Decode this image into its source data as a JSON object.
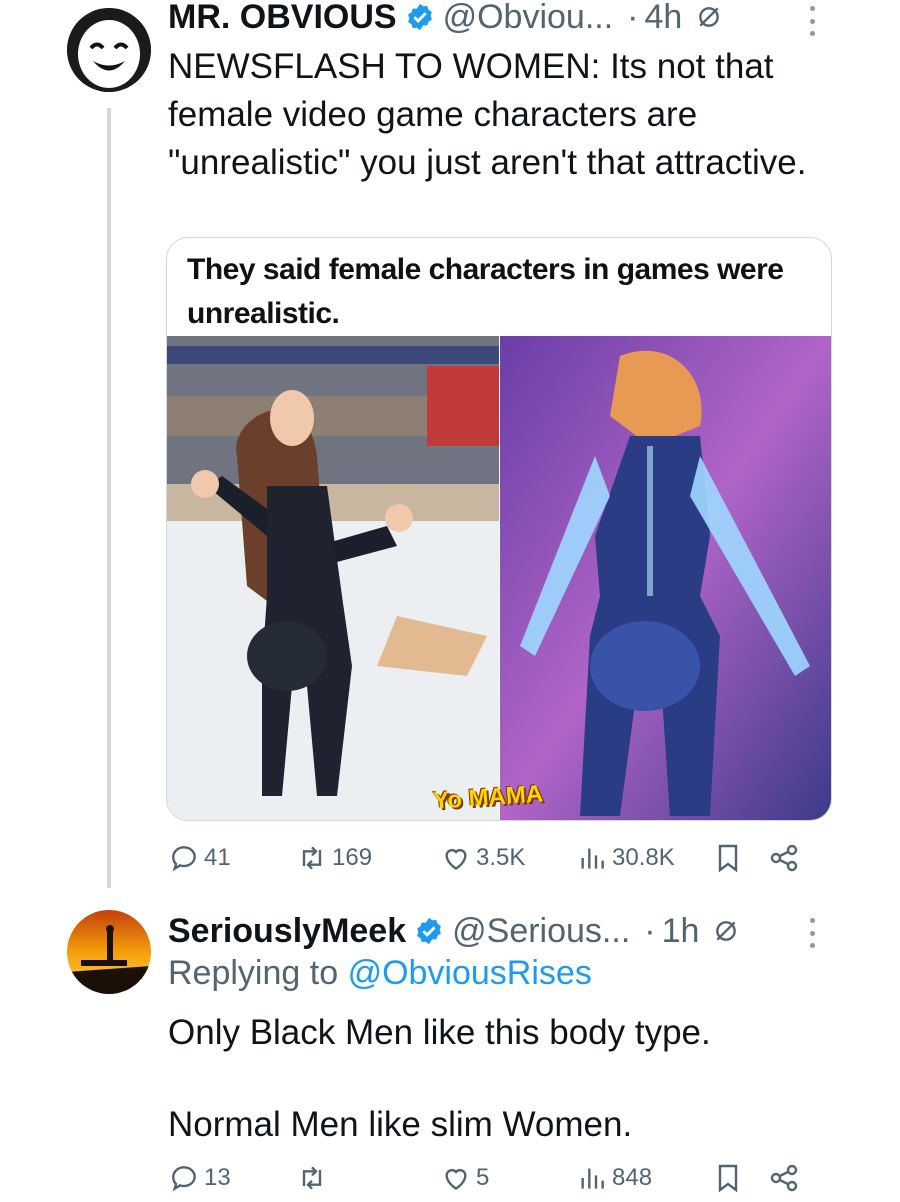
{
  "tweet1": {
    "name": "MR. OBVIOUS",
    "handle": "@Obviou...",
    "time": "4h",
    "text": "NEWSFLASH TO WOMEN: Its not that female video game characters are \"unrealistic\" you just aren't that attractive.",
    "media": {
      "caption": "They said female characters in games were unrealistic.",
      "watermark": "Yo MAMA"
    },
    "stats": {
      "replies": "41",
      "retweets": "169",
      "likes": "3.5K",
      "views": "30.8K"
    }
  },
  "tweet2": {
    "name": "SeriouslyMeek",
    "handle": "@Serious...",
    "time": "1h",
    "replying_prefix": "Replying to",
    "replying_to": "@ObviousRises",
    "text": "Only Black Men like this body type.\n\nNormal Men like slim Women.",
    "stats": {
      "replies": "13",
      "retweets": "",
      "likes": "5",
      "views": "848"
    }
  },
  "colors": {
    "verified": "#1d9bf0",
    "link": "#1d9bf0",
    "muted": "#536471",
    "thread_line": "#cfd9de"
  },
  "icons": [
    "verified-icon",
    "restricted-icon",
    "more-icon",
    "reply-icon",
    "retweet-icon",
    "like-icon",
    "views-icon",
    "bookmark-icon",
    "share-icon"
  ]
}
